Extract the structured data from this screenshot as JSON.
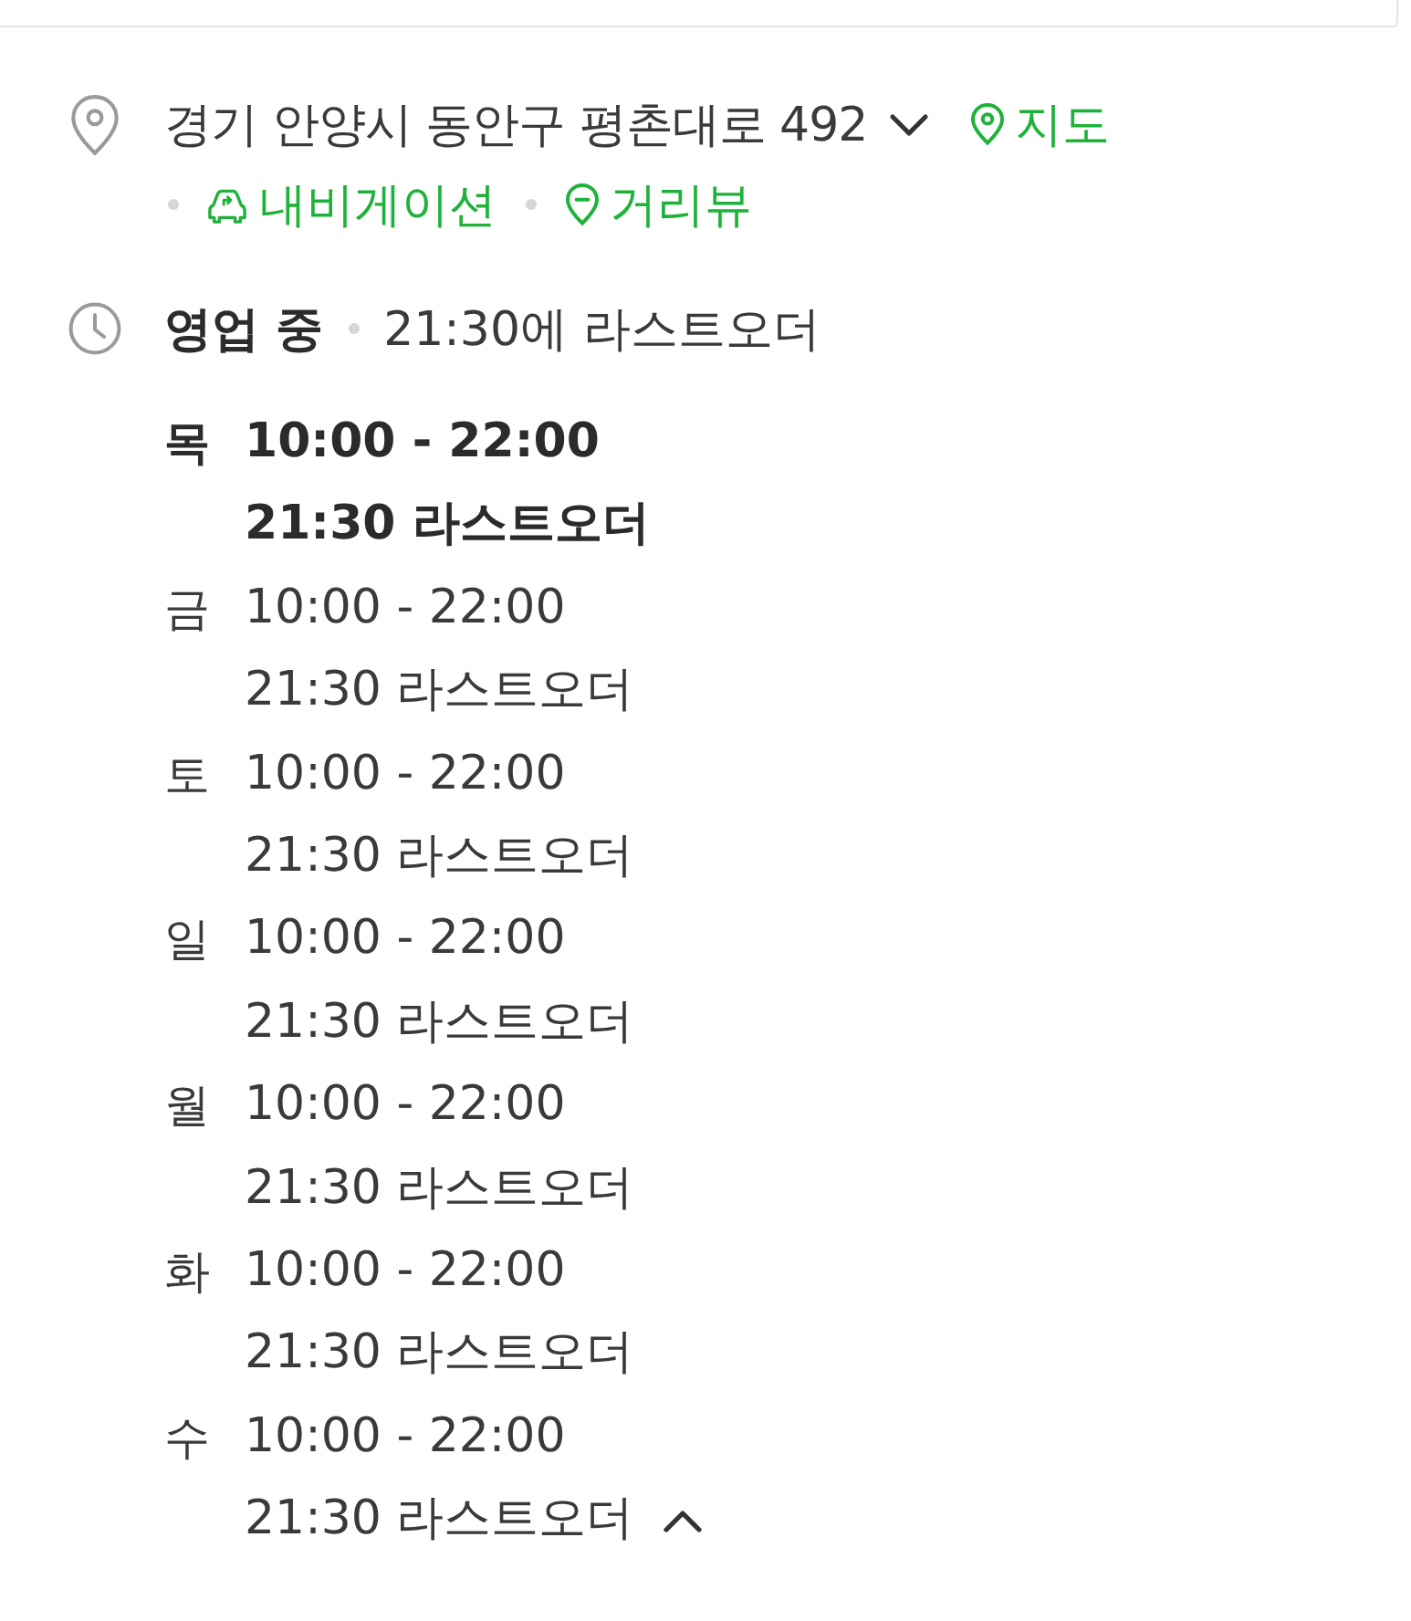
{
  "address": {
    "text": "경기 안양시 동안구 평촌대로 492",
    "expanded": false,
    "links": [
      {
        "kind": "map",
        "label": "지도"
      },
      {
        "kind": "navigation",
        "label": "내비게이션"
      },
      {
        "kind": "street_view",
        "label": "거리뷰"
      }
    ]
  },
  "hours": {
    "status": "영업 중",
    "note": "21:30에 라스트오더",
    "expanded": true,
    "days": [
      {
        "day": "목",
        "time": "10:00 - 22:00",
        "last_order": "21:30 라스트오더",
        "today": true
      },
      {
        "day": "금",
        "time": "10:00 - 22:00",
        "last_order": "21:30 라스트오더",
        "today": false
      },
      {
        "day": "토",
        "time": "10:00 - 22:00",
        "last_order": "21:30 라스트오더",
        "today": false
      },
      {
        "day": "일",
        "time": "10:00 - 22:00",
        "last_order": "21:30 라스트오더",
        "today": false
      },
      {
        "day": "월",
        "time": "10:00 - 22:00",
        "last_order": "21:30 라스트오더",
        "today": false
      },
      {
        "day": "화",
        "time": "10:00 - 22:00",
        "last_order": "21:30 라스트오더",
        "today": false
      },
      {
        "day": "수",
        "time": "10:00 - 22:00",
        "last_order": "21:30 라스트오더",
        "today": false
      }
    ]
  }
}
